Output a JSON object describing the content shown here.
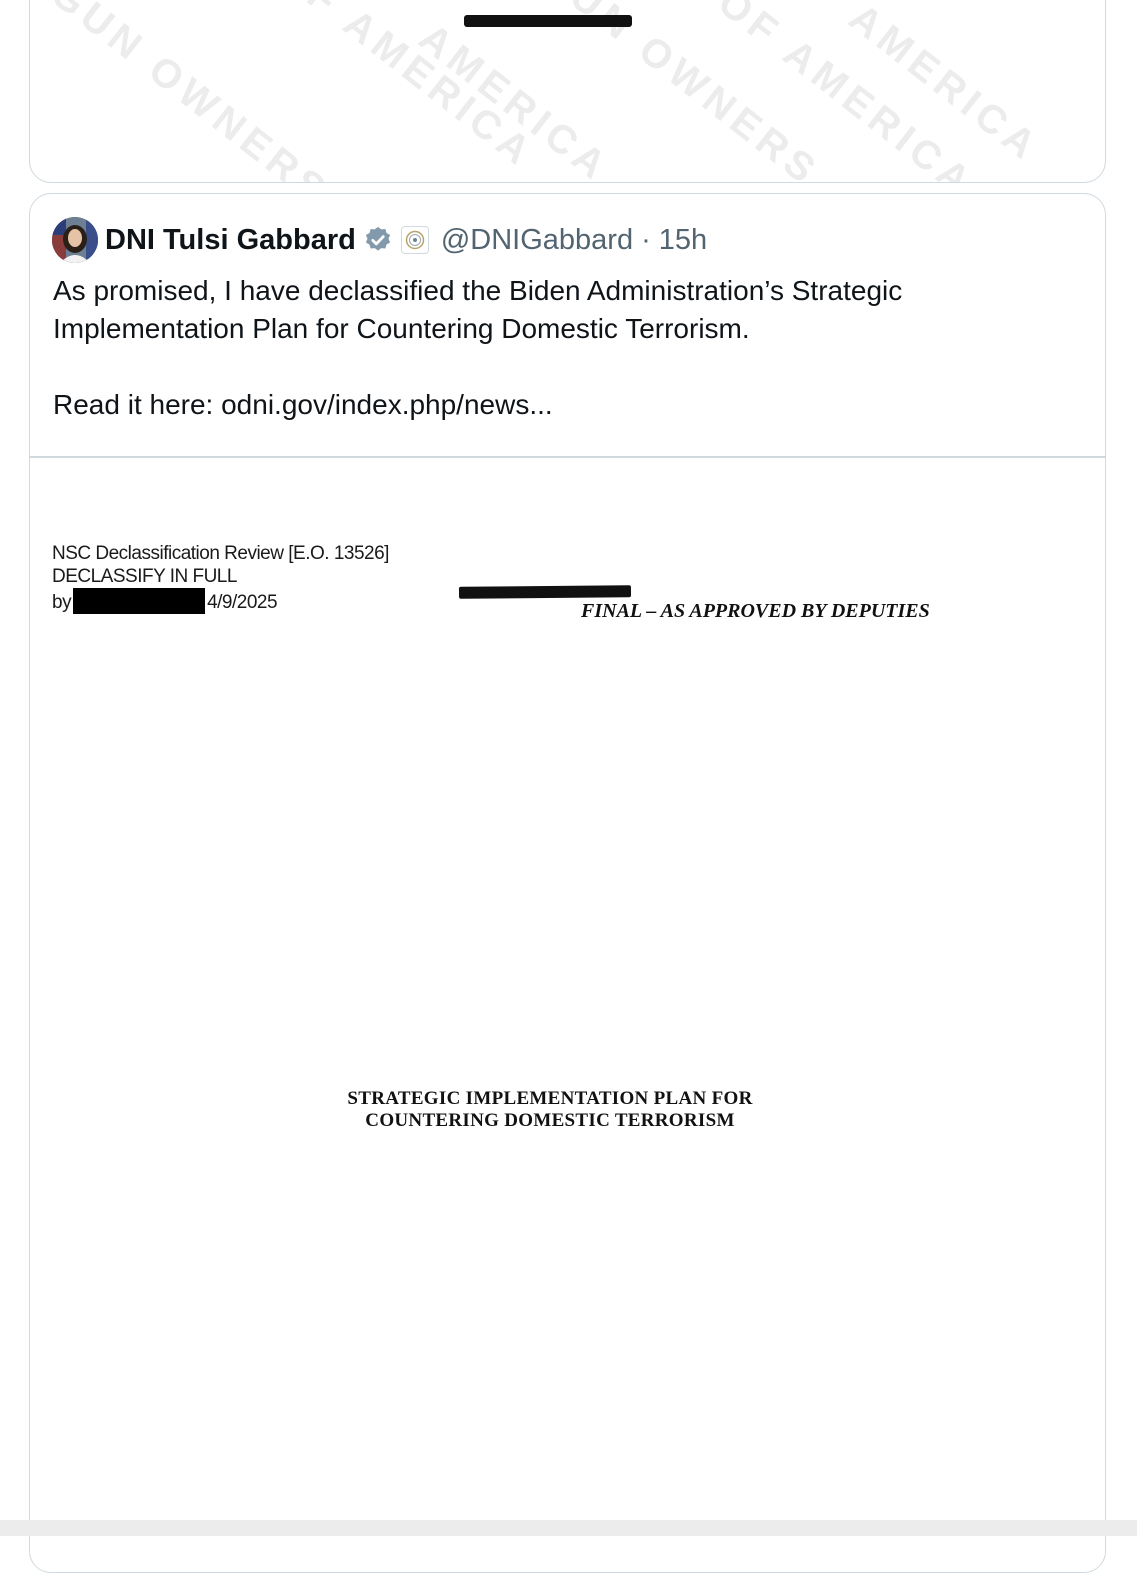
{
  "previous_tweet": {
    "watermark_words": [
      "GUN OWNERS",
      "OF AMERICA",
      "AMERICA",
      "GUN OWNERS",
      "OF AMERICA",
      "AMERICA"
    ]
  },
  "tweet": {
    "display_name": "DNI Tulsi Gabbard",
    "handle": "@DNIGabbard",
    "separator": "·",
    "timestamp": "15h",
    "text_line1": "As promised, I have declassified the Biden Administration’s Strategic",
    "text_line2": "Implementation Plan for Countering Domestic Terrorism.",
    "text_read_prefix": "Read it here: ",
    "link_text": "odni.gov/index.php/news..."
  },
  "document": {
    "review_line": "NSC Declassification Review [E.O. 13526]",
    "declassify_line": "DECLASSIFY IN FULL",
    "by_label": "by",
    "date": "4/9/2025",
    "status_line": "FINAL – AS APPROVED BY DEPUTIES",
    "title_line1": "STRATEGIC IMPLEMENTATION PLAN FOR",
    "title_line2": "COUNTERING DOMESTIC TERRORISM"
  },
  "colors": {
    "border": "#cfd9de",
    "secondary_text": "#536471",
    "verified_badge": "#829aab",
    "redaction": "#000000"
  },
  "icons": {
    "verified": "verified-badge-icon",
    "affiliate": "affiliate-seal-icon"
  }
}
